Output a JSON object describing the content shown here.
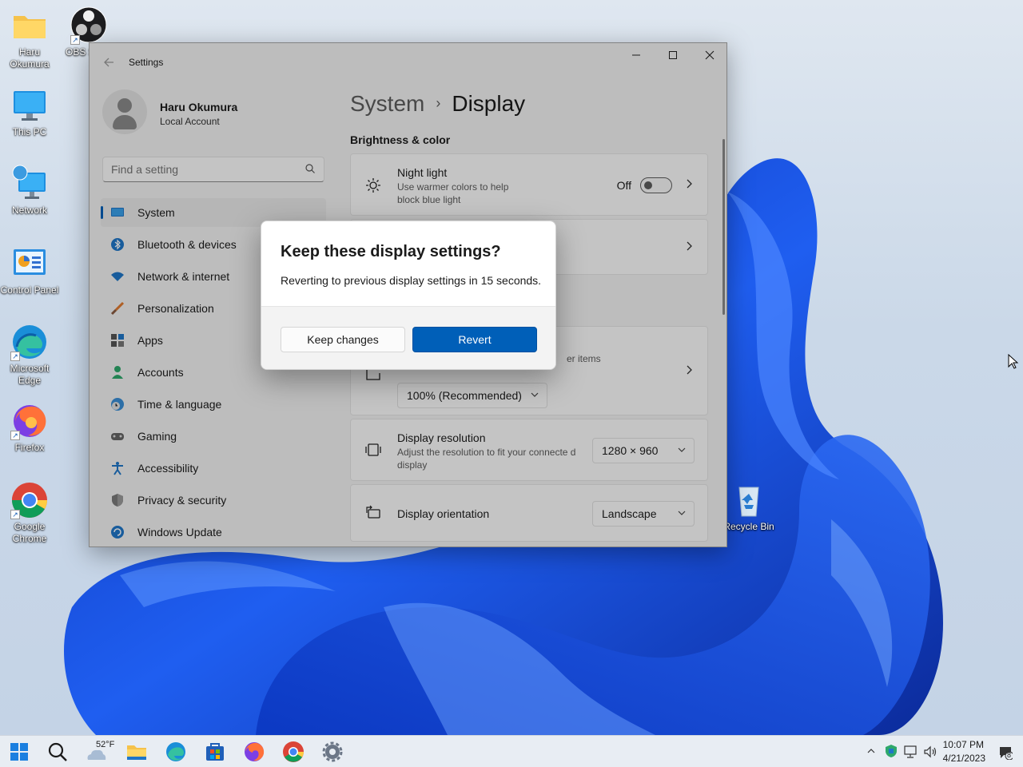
{
  "desktop": {
    "icons": [
      {
        "label": "Haru Okumura",
        "icon": "folder-icon"
      },
      {
        "label": "OBS S",
        "icon": "obs-icon"
      },
      {
        "label": "This PC",
        "icon": "monitor-icon"
      },
      {
        "label": "Network",
        "icon": "network-icon"
      },
      {
        "label": "Control Panel",
        "icon": "control-panel-icon"
      },
      {
        "label": "Microsoft Edge",
        "icon": "edge-icon"
      },
      {
        "label": "Firefox",
        "icon": "firefox-icon"
      },
      {
        "label": "Google Chrome",
        "icon": "chrome-icon"
      },
      {
        "label": "Recycle Bin",
        "icon": "recycle-bin-icon"
      }
    ]
  },
  "settings": {
    "app_title": "Settings",
    "user": {
      "name": "Haru Okumura",
      "account": "Local Account"
    },
    "search_placeholder": "Find a setting",
    "nav": [
      {
        "label": "System",
        "active": true
      },
      {
        "label": "Bluetooth & devices"
      },
      {
        "label": "Network & internet"
      },
      {
        "label": "Personalization"
      },
      {
        "label": "Apps"
      },
      {
        "label": "Accounts"
      },
      {
        "label": "Time & language"
      },
      {
        "label": "Gaming"
      },
      {
        "label": "Accessibility"
      },
      {
        "label": "Privacy & security"
      },
      {
        "label": "Windows Update"
      }
    ],
    "breadcrumb": {
      "parent": "System",
      "separator": "›",
      "current": "Display"
    },
    "section_title": "Brightness & color",
    "night_light": {
      "title": "Night light",
      "desc": "Use warmer colors to help block blue light",
      "state": "Off"
    },
    "scale": {
      "partial_desc": "er items",
      "value": "100% (Recommended)"
    },
    "resolution": {
      "title": "Display resolution",
      "desc": "Adjust the resolution to fit your connecte d display",
      "value": "1280 × 960"
    },
    "orientation": {
      "title": "Display orientation",
      "value": "Landscape"
    }
  },
  "dialog": {
    "title": "Keep these display settings?",
    "message": "Reverting to previous display settings in 15 seconds.",
    "keep_label": "Keep changes",
    "revert_label": "Revert"
  },
  "taskbar": {
    "weather_temp": "52°F",
    "time": "10:07 PM",
    "date": "4/21/2023",
    "notification_count": "8"
  },
  "colors": {
    "accent": "#005fb8",
    "wallpaper_blue": "#1747d8"
  }
}
